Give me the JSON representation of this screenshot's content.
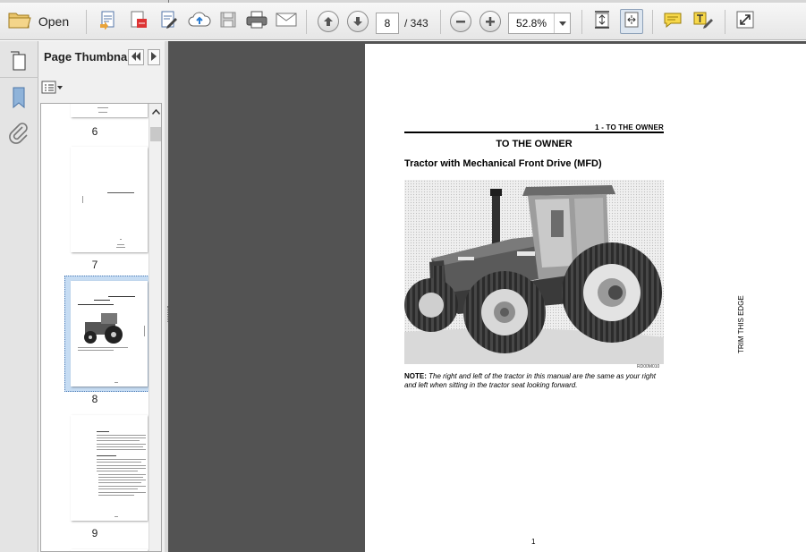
{
  "toolbar": {
    "open_label": "Open",
    "current_page": "8",
    "total_pages": "/ 343",
    "zoom": "52.8%",
    "icons": [
      "open-folder-icon",
      "create-pdf-icon",
      "convert-icon",
      "edit-icon",
      "upload-cloud-icon",
      "save-icon",
      "print-icon",
      "email-icon",
      "previous-page-icon",
      "next-page-icon",
      "zoom-out-icon",
      "zoom-in-icon",
      "fit-page-icon",
      "fit-width-icon",
      "comment-icon",
      "highlight-icon",
      "full-screen-icon"
    ]
  },
  "panel": {
    "title": "Page Thumbnails",
    "title_display": "Page Thumbna...",
    "thumbnails": [
      {
        "label": "6"
      },
      {
        "label": "7"
      },
      {
        "label": "8",
        "selected": true
      },
      {
        "label": "9"
      }
    ]
  },
  "document": {
    "header": "1 - TO THE OWNER",
    "title": "TO THE OWNER",
    "subtitle": "Tractor with Mechanical Front Drive (MFD)",
    "photo_code": "RD00M010",
    "note_label": "NOTE:",
    "note_text": " The right and left of the tractor in this manual are the same as your right and left when sitting in the tractor seat looking forward.",
    "side_text": "TRIM THIS EDGE",
    "page_number": "1"
  },
  "colors": {
    "doc_background": "#535353",
    "selection": "#c6dcf3",
    "toolbar": "#eeeeee"
  }
}
